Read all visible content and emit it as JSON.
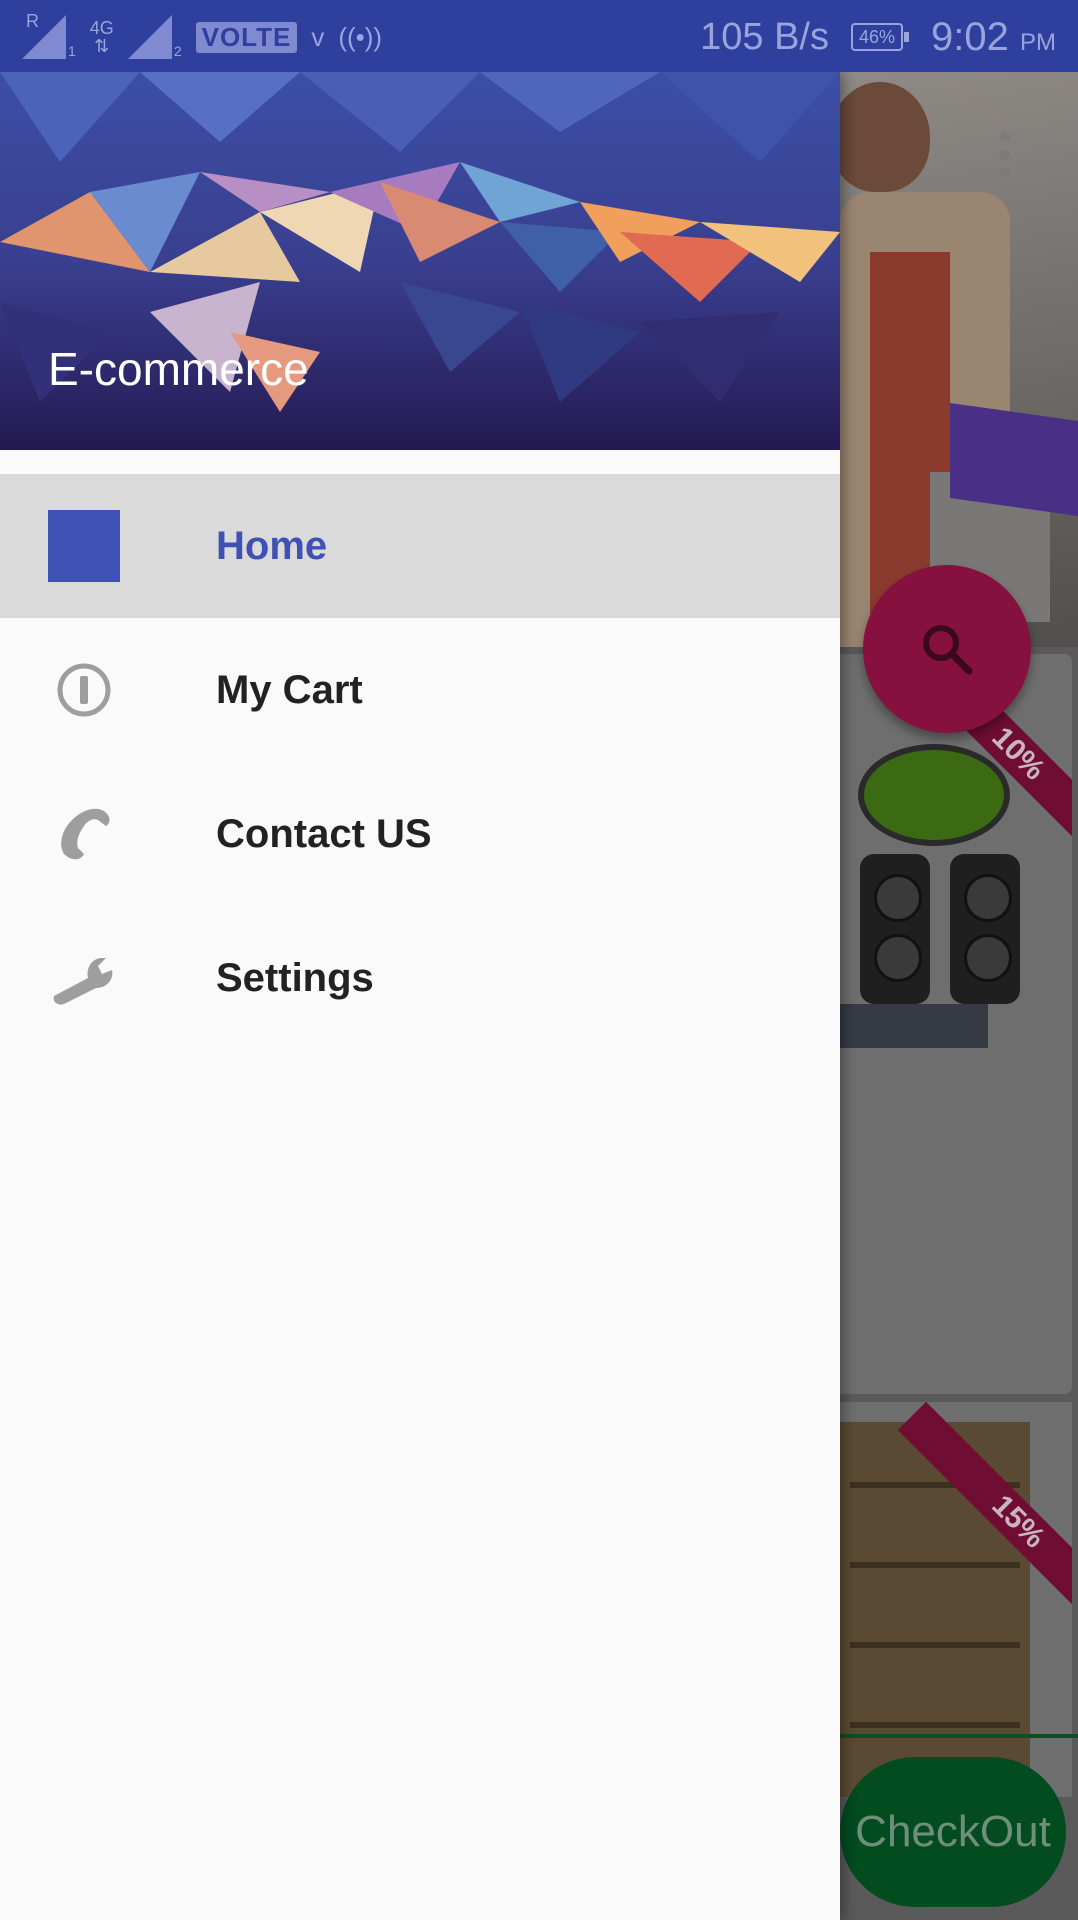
{
  "status_bar": {
    "sim1_roaming": "R",
    "sim1_index": "1",
    "network_type": "4G",
    "sim2_index": "2",
    "volte": "VOLTE",
    "extra_icon": "v",
    "net_speed": "105 B/s",
    "battery": "46%",
    "time": "9:02",
    "meridiem": "PM"
  },
  "drawer": {
    "header_title": "E-commerce",
    "items": [
      {
        "label": "Home",
        "icon": "home-square-icon",
        "active": true
      },
      {
        "label": "My Cart",
        "icon": "info-icon",
        "active": false
      },
      {
        "label": "Contact US",
        "icon": "phone-icon",
        "active": false
      },
      {
        "label": "Settings",
        "icon": "wrench-icon",
        "active": false
      }
    ]
  },
  "background": {
    "discount_1": "10%",
    "discount_2": "15%",
    "checkout_label": "CheckOut"
  },
  "colors": {
    "status_bar": "#2e3f9e",
    "accent": "#3f51b5",
    "fab": "#c2185b",
    "checkout": "#00a651"
  }
}
